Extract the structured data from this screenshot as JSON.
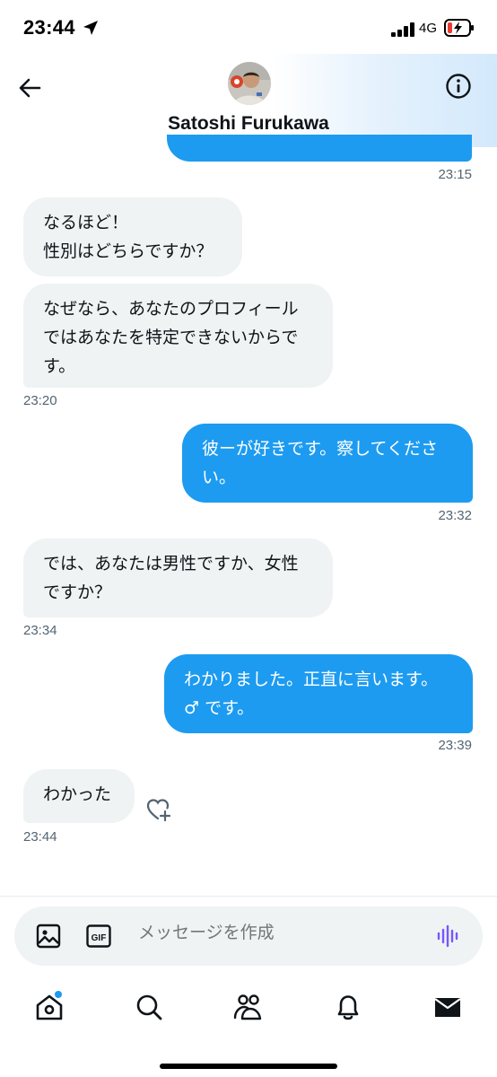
{
  "status_bar": {
    "time": "23:44",
    "network": "4G"
  },
  "header": {
    "contact_name": "Satoshi Furukawa"
  },
  "messages": [
    {
      "direction": "out",
      "lines": [],
      "time": "23:15"
    },
    {
      "direction": "in",
      "lines": [
        "なるほど！",
        "性別はどちらですか？"
      ]
    },
    {
      "direction": "in",
      "lines": [
        "なぜなら、あなたのプロフィール",
        "ではあなたを特定できないからで",
        "す。"
      ],
      "time": "23:20"
    },
    {
      "direction": "out",
      "lines": [
        "彼ーが好きです。察してくださ",
        "い。"
      ],
      "time": "23:32"
    },
    {
      "direction": "in",
      "lines": [
        "では、あなたは男性ですか、女性",
        "ですか？"
      ],
      "time": "23:34"
    },
    {
      "direction": "out",
      "lines": [
        "わかりました。正直に言います。",
        "♂ です。"
      ],
      "time": "23:39"
    },
    {
      "direction": "in",
      "lines": [
        "わかった"
      ],
      "time": "23:44"
    }
  ],
  "composer": {
    "placeholder": "メッセージを作成",
    "gif_label": "GIF"
  },
  "icons": {
    "back": "arrow-left-icon",
    "info": "info-icon",
    "image": "image-icon",
    "gif": "gif-icon",
    "voice": "voice-wave-icon",
    "react": "heart-plus-icon",
    "nav": [
      "home-icon",
      "search-icon",
      "communities-icon",
      "notifications-icon",
      "messages-icon"
    ]
  },
  "colors": {
    "accent": "#1d9bf0",
    "incoming_bubble": "#eff3f4",
    "secondary_text": "#536471",
    "voice": "#7856ff"
  }
}
